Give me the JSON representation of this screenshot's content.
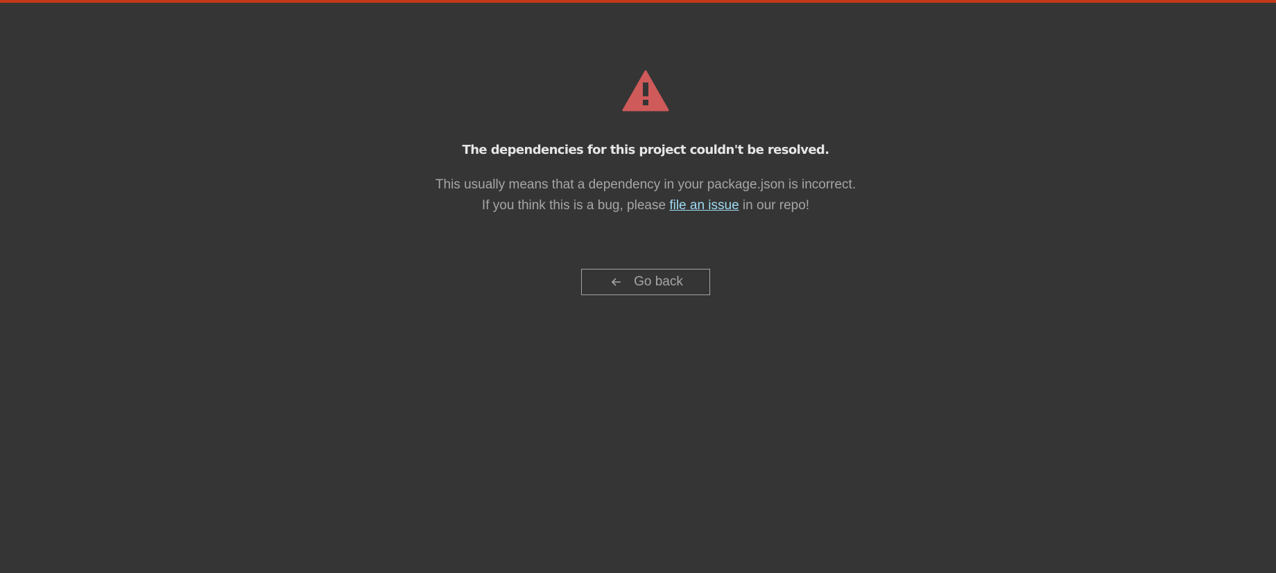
{
  "header": {
    "accent_color": "#c4381a"
  },
  "error": {
    "icon": "warning-triangle-icon",
    "icon_color": "#cf5a5a",
    "title": "The dependencies for this project couldn't be resolved.",
    "line1": "This usually means that a dependency in your package.json is incorrect.",
    "line2_prefix": "If you think this is a bug, please ",
    "link_text": "file an issue",
    "line2_suffix": " in our repo!"
  },
  "actions": {
    "back_icon": "arrow-left-icon",
    "back_label": "Go back"
  }
}
